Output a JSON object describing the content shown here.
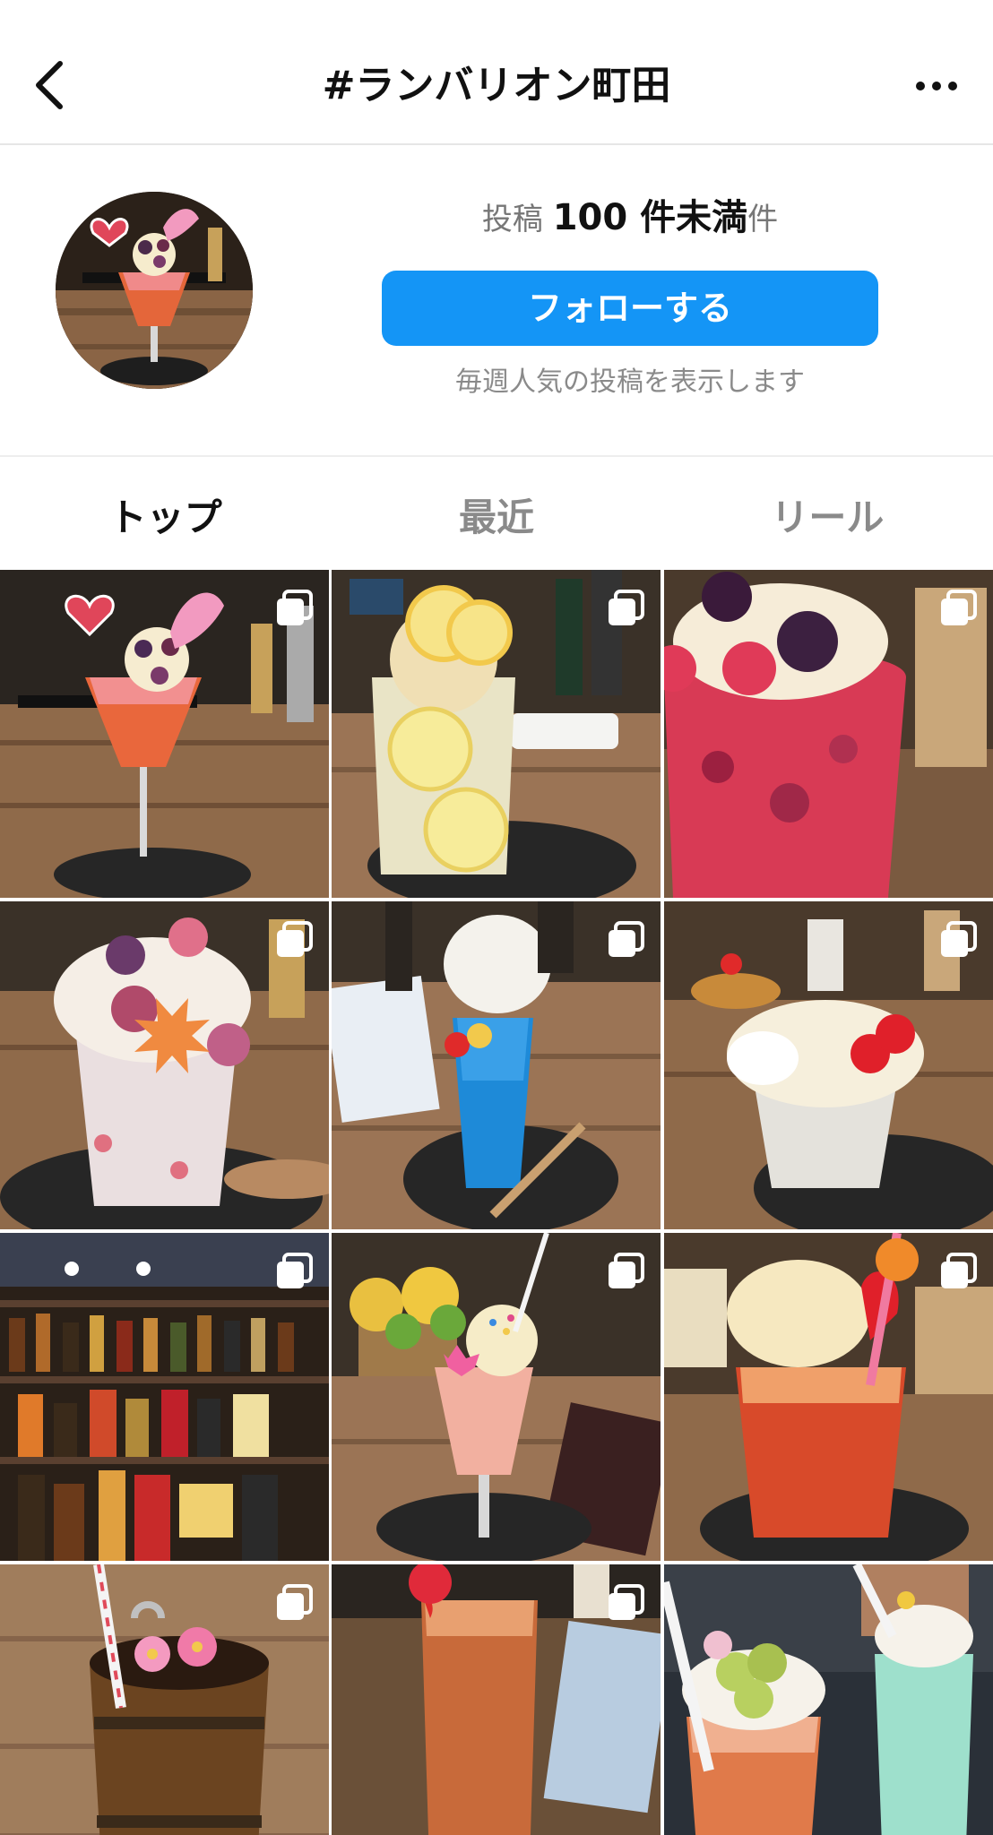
{
  "header": {
    "title": "#ランバリオン町田",
    "back_icon": "chevron-left-icon",
    "more_icon": "more-horizontal-icon"
  },
  "profile": {
    "posts_prefix": "投稿",
    "posts_count": "100 件未満",
    "posts_suffix": "件",
    "follow_label": "フォローする",
    "sub_note": "毎週人気の投稿を表示します"
  },
  "tabs": [
    {
      "label": "トップ",
      "active": true
    },
    {
      "label": "最近",
      "active": false
    },
    {
      "label": "リール",
      "active": false
    }
  ],
  "colors": {
    "accent": "#1495f6",
    "tab_inactive": "#8a8a8a"
  },
  "grid": {
    "tiles": [
      {
        "subject": "pink cocktail with cotton candy and berries",
        "carousel": true
      },
      {
        "subject": "lemon float with ice cream",
        "carousel": true
      },
      {
        "subject": "red berry float",
        "carousel": true
      },
      {
        "subject": "berry parfait with flower",
        "carousel": true
      },
      {
        "subject": "blue soda float with cotton candy",
        "carousel": true
      },
      {
        "subject": "cream float with cherries",
        "carousel": true
      },
      {
        "subject": "bar shelf of bottles",
        "carousel": true
      },
      {
        "subject": "pink float with flower and sprinkles",
        "carousel": true
      },
      {
        "subject": "orange float with ice cream and strawberry",
        "carousel": true
      },
      {
        "subject": "wooden bucket drink with flowers",
        "carousel": true
      },
      {
        "subject": "tall iced tea glass",
        "carousel": true
      },
      {
        "subject": "grape and melon floats",
        "carousel": false
      }
    ]
  }
}
